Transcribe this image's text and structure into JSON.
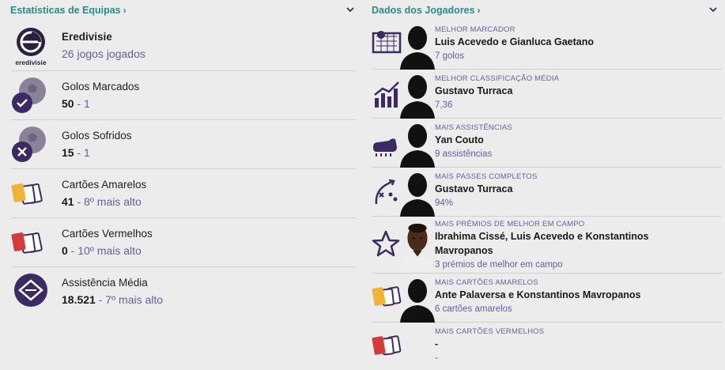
{
  "team_stats": {
    "title": "Estatísticas de Equipas",
    "rows": [
      {
        "icon": "eredivisie-logo-icon",
        "title": "Eredivisie",
        "value": "",
        "rest": "26 jogos jogados",
        "logo_text": "eredivisie"
      },
      {
        "icon": "ball-check-icon",
        "title": "Golos Marcados",
        "value": "50",
        "rest": " - 1"
      },
      {
        "icon": "ball-cross-icon",
        "title": "Golos Sofridos",
        "value": "15",
        "rest": " - 1"
      },
      {
        "icon": "yellow-cards-icon",
        "title": "Cartões Amarelos",
        "value": "41",
        "rest": " - 8º mais alto"
      },
      {
        "icon": "red-cards-icon",
        "title": "Cartões Vermelhos",
        "value": "0",
        "rest": " - 10º mais alto"
      },
      {
        "icon": "stadium-icon",
        "title": "Assistência Média",
        "value": "18.521",
        "rest": " - 7º mais alto"
      }
    ]
  },
  "player_stats": {
    "title": "Dados dos Jogadores",
    "rows": [
      {
        "icon": "goal-net-icon",
        "category": "Melhor Marcador",
        "name": "Luis Acevedo e Gianluca Gaetano",
        "value": "7 golos"
      },
      {
        "icon": "rating-chart-icon",
        "category": "Melhor Classificação Média",
        "name": "Gustavo Turraca",
        "value": "7,36"
      },
      {
        "icon": "boot-icon",
        "category": "Mais Assistências",
        "name": "Yan Couto",
        "value": "9 assistências"
      },
      {
        "icon": "tactics-icon",
        "category": "Mais Passes Completos",
        "name": "Gustavo Turraca",
        "value": "94%"
      },
      {
        "icon": "star-icon",
        "category": "Mais Prémios de Melhor em Campo",
        "name": "Ibrahima Cissé, Luis Acevedo e Konstantinos Mavropanos",
        "value": "3 prémios de melhor em campo"
      },
      {
        "icon": "yellow-cards-icon",
        "category": "Mais Cartões Amarelos",
        "name": "Ante Palaversa e Konstantinos Mavropanos",
        "value": "6 cartões amarelos"
      },
      {
        "icon": "red-cards-icon",
        "category": "Mais Cartões Vermelhos",
        "name": "-",
        "value": "-"
      }
    ]
  },
  "colors": {
    "accent": "#2a8a87",
    "purple": "#3b2a63",
    "muted": "#6a5ca0",
    "yellow_card": "#f2b233",
    "red_card": "#d63b3b"
  }
}
